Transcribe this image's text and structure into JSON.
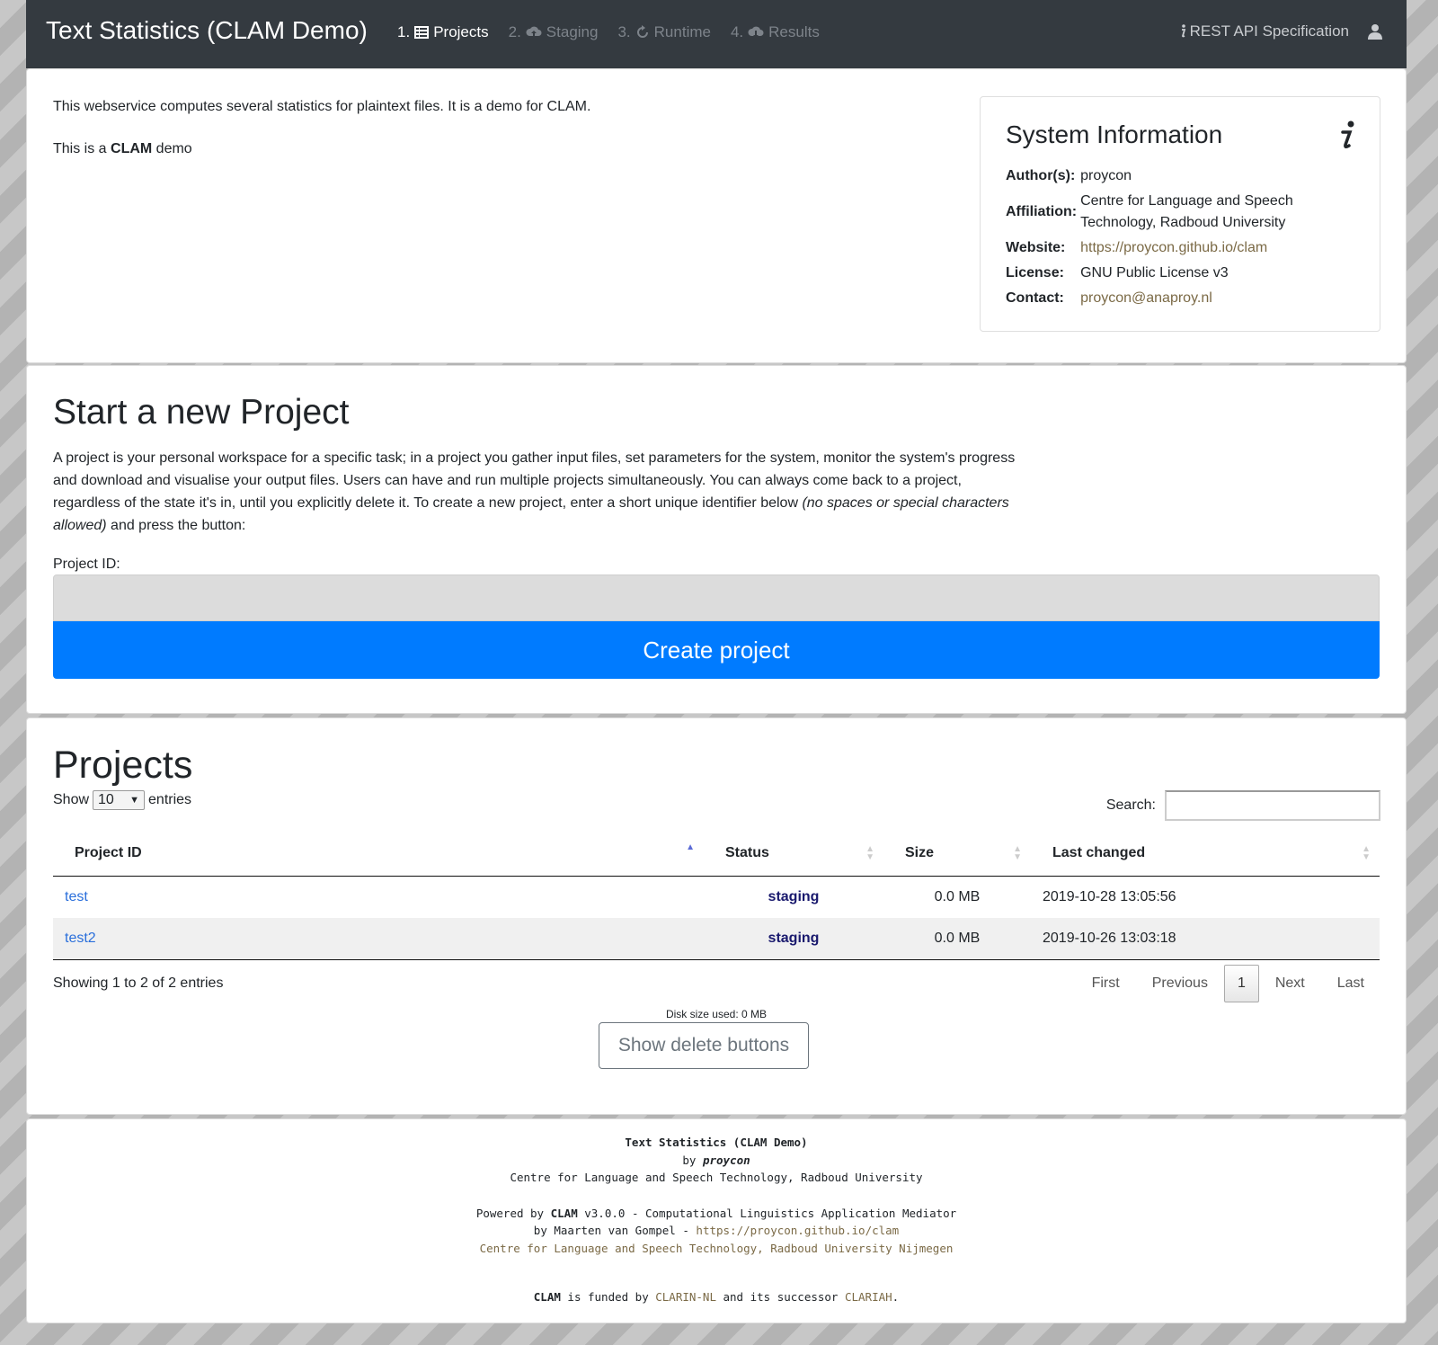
{
  "navbar": {
    "brand": "Text Statistics (CLAM Demo)",
    "steps": [
      {
        "num": "1.",
        "label": "Projects",
        "icon": "list-icon"
      },
      {
        "num": "2.",
        "label": "Staging",
        "icon": "cloud-upload-icon"
      },
      {
        "num": "3.",
        "label": "Runtime",
        "icon": "refresh-icon"
      },
      {
        "num": "4.",
        "label": "Results",
        "icon": "cloud-download-icon"
      }
    ],
    "api_label": "REST API Specification",
    "user_icon": "user-icon"
  },
  "intro": {
    "description": "This webservice computes several statistics for plaintext files. It is a demo for CLAM.",
    "demo_prefix": "This is a ",
    "demo_bold": "CLAM",
    "demo_suffix": " demo"
  },
  "system_info": {
    "title": "System Information",
    "rows": [
      {
        "key": "Author(s):",
        "value": "proycon"
      },
      {
        "key": "Affiliation:",
        "value": "Centre for Language and Speech Technology, Radboud University"
      },
      {
        "key": "Website:",
        "value": "https://proycon.github.io/clam"
      },
      {
        "key": "License:",
        "value": "GNU Public License v3"
      },
      {
        "key": "Contact:",
        "value": "proycon@anaproy.nl"
      }
    ]
  },
  "new_project": {
    "title": "Start a new Project",
    "desc_main": "A project is your personal workspace for a specific task; in a project you gather input files, set parameters for the system, monitor the system's progress and download and visualise your output files. Users can have and run multiple projects simultaneously. You can always come back to a project, regardless of the state it's in, until you explicitly delete it. To create a new project, enter a short unique identifier below ",
    "desc_italic": "(no spaces or special characters allowed)",
    "desc_end": " and press the button:",
    "input_label": "Project ID:",
    "input_value": "",
    "button_label": "Create project"
  },
  "projects": {
    "title": "Projects",
    "show_label": "Show",
    "entries_value": "10",
    "entries_label": "entries",
    "search_label": "Search:",
    "columns": [
      "Project ID",
      "Status",
      "Size",
      "Last changed"
    ],
    "rows": [
      {
        "id": "test",
        "status": "staging",
        "size": "0.0 MB",
        "changed": "2019-10-28 13:05:56"
      },
      {
        "id": "test2",
        "status": "staging",
        "size": "0.0 MB",
        "changed": "2019-10-26 13:03:18"
      }
    ],
    "showing": "Showing 1 to 2 of 2 entries",
    "pager": {
      "first": "First",
      "previous": "Previous",
      "current": "1",
      "next": "Next",
      "last": "Last"
    },
    "disk": "Disk size used: 0 MB",
    "delete_button": "Show delete buttons"
  },
  "footer": {
    "app_name": "Text Statistics (CLAM Demo)",
    "by": "by ",
    "author": "proycon",
    "affiliation": "Centre for Language and Speech Technology, Radboud University",
    "powered_prefix": "Powered by ",
    "powered_bold": "CLAM",
    "powered_rest": " v3.0.0 - Computational Linguistics Application Mediator",
    "by_maarten": "by Maarten van Gompel - ",
    "clam_url": "https://proycon.github.io/clam",
    "cls_link": "Centre for Language and Speech Technology, Radboud University Nijmegen",
    "funded_bold": "CLAM",
    "funded_mid": " is funded by ",
    "clarin": "CLARIN-NL",
    "and_succ": " and its successor ",
    "clariah": "CLARIAH",
    "period": "."
  },
  "colors": {
    "primary": "#007bff",
    "navbar": "#343a40",
    "link": "#7b6a46",
    "status": "#1a1a6e"
  }
}
